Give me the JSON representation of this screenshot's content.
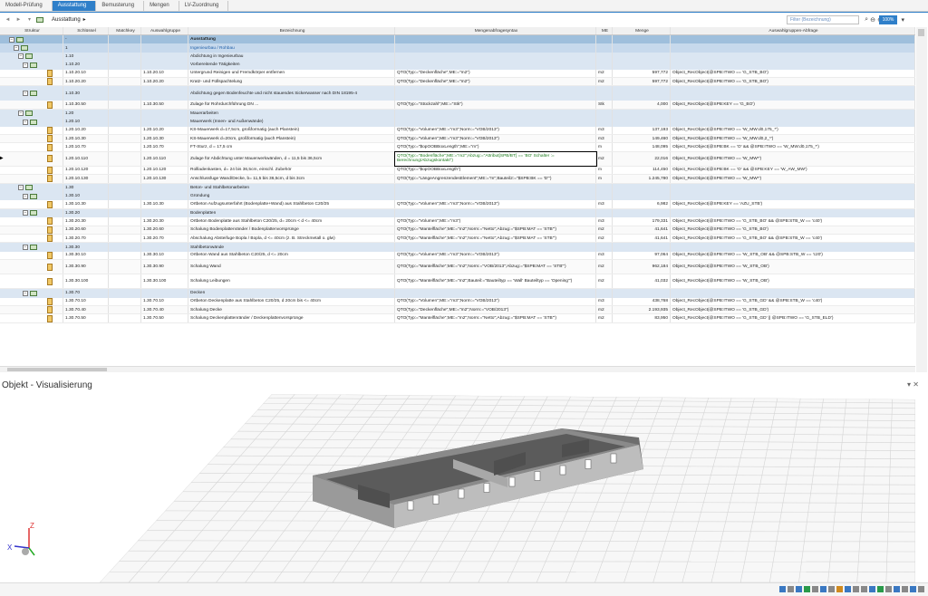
{
  "wizard": {
    "steps": [
      {
        "label": "Modell-Prüfung"
      },
      {
        "label": "Ausstattung"
      },
      {
        "label": "Bemusterung"
      },
      {
        "label": "Mengen"
      },
      {
        "label": "LV-Zuordnung"
      }
    ]
  },
  "toolbar": {
    "combo_value": "Ausstattung",
    "filter_placeholder": "Filter (Bezeichnung)",
    "zoom_value": "100%"
  },
  "columns": {
    "struktur": "Struktur",
    "schluessel": "Schlüssel",
    "matchkey": "Matchkey",
    "auswahlgruppe": "Auswahlgruppe",
    "bezeichnung": "Bezeichnung",
    "mengenabfrage": "Mengenabfragesyntax",
    "me": "ME",
    "menge": "Menge",
    "abfrage": "Auswahlgruppen-Abfrage"
  },
  "rows": [
    {
      "kind": "g0",
      "level": 0,
      "icon": "tree",
      "key": "-",
      "group": "",
      "name": "Ausstattung",
      "syntax": "",
      "me": "",
      "qty": "",
      "query": ""
    },
    {
      "kind": "g1",
      "level": 1,
      "icon": "tree",
      "key": "1",
      "group": "",
      "name": "Ingenieurbau / Rohbau",
      "syntax": "",
      "me": "",
      "qty": "",
      "query": ""
    },
    {
      "kind": "g2",
      "level": 2,
      "icon": "tree",
      "key": "1.10",
      "group": "",
      "name": "Abdichtung in Ingenieurbau",
      "syntax": "",
      "me": "",
      "qty": "",
      "query": ""
    },
    {
      "kind": "g2",
      "level": 3,
      "icon": "tree",
      "key": "1.10.20",
      "group": "",
      "name": "Vorbereitende Tätigkeiten",
      "syntax": "",
      "me": "",
      "qty": "",
      "query": ""
    },
    {
      "kind": "leaf",
      "level": 4,
      "icon": "pos",
      "key": "1.10.20.10",
      "group": "1.10.20.10",
      "name": "Untergrund Reinigen und Fremdkörper entfernen",
      "syntax": "QTO(Typ:=\"Deckenfläche\";ME:=\"m2\")",
      "me": "m2",
      "qty": "597,772",
      "query": "Object_RecObject(@SPB:ITWO == 'G_STB_BO')"
    },
    {
      "kind": "leaf",
      "level": 4,
      "icon": "pos",
      "key": "1.10.20.20",
      "group": "1.10.20.20",
      "name": "Kratz- und Füllspachtelung",
      "syntax": "QTO(Typ:=\"Deckenfläche\";ME:=\"m2\")",
      "me": "m2",
      "qty": "597,772",
      "query": "Object_RecObject(@SPB:ITWO == 'G_STB_BO')"
    },
    {
      "kind": "g2",
      "level": 3,
      "icon": "tree",
      "key": "1.10.30",
      "group": "",
      "name": "Abdichtung gegen Bodenfeuchte und nicht stauendes Sickerwasser nach DIN 18195-4",
      "syntax": "",
      "me": "",
      "qty": "",
      "query": "",
      "tall": true
    },
    {
      "kind": "leaf",
      "level": 4,
      "icon": "pos",
      "key": "1.10.30.50",
      "group": "1.10.30.50",
      "name": "Zulage für Rohrdurchführung DN ...",
      "syntax": "QTO(Typ:=\"Stückzahl\";ME:=\"Stk\")",
      "me": "Stk",
      "qty": "4,000",
      "query": "Object_RecObject(@SPB:KEY == 'G_BO')"
    },
    {
      "kind": "g2",
      "level": 2,
      "icon": "tree",
      "key": "1.20",
      "group": "",
      "name": "Mauerarbeiten",
      "syntax": "",
      "me": "",
      "qty": "",
      "query": ""
    },
    {
      "kind": "g2",
      "level": 3,
      "icon": "tree",
      "key": "1.20.10",
      "group": "",
      "name": "Mauerwerk (Innen- und Außenwände)",
      "syntax": "",
      "me": "",
      "qty": "",
      "query": ""
    },
    {
      "kind": "leaf",
      "level": 4,
      "icon": "pos",
      "key": "1.20.10.20",
      "group": "1.20.10.20",
      "name": "KS-Mauerwerk d=17,5cm, großformatig (auch Planstein)",
      "syntax": "QTO(Typ:=\"Volumen\";ME:=\"m3\";Norm:=\"VOB/2013\")",
      "me": "m3",
      "qty": "137,193",
      "query": "Object_RecObject(@SPB:ITWO == 'W_MW:d0,175_*')"
    },
    {
      "kind": "leaf",
      "level": 4,
      "icon": "pos",
      "key": "1.20.10.30",
      "group": "1.20.10.30",
      "name": "KS-Mauerwerk d=20cm, großformatig (auch Planstein)",
      "syntax": "QTO(Typ:=\"Volumen\";ME:=\"m3\";Norm:=\"VOB/2013\")",
      "me": "m3",
      "qty": "149,460",
      "query": "Object_RecObject(@SPB:ITWO == 'W_MW:d0,2_*')"
    },
    {
      "kind": "leaf",
      "level": 4,
      "icon": "pos",
      "key": "1.20.10.70",
      "group": "1.20.10.70",
      "name": "FT-Sturz, d = 17,5 cm",
      "syntax": "QTO(Typ:=\"$opOOBBoxLength\";ME:=\"m\")",
      "me": "m",
      "qty": "148,095",
      "query": "Object_RecObject(@SPB:BK == 'O' && @SPB:ITWO == 'W_MW:d0,175_*')"
    },
    {
      "kind": "leaf",
      "level": 4,
      "icon": "pos",
      "key": "1.20.10.110",
      "group": "1.20.10.110",
      "name": "Zulage für Abdichtung unter Mauerwerkwänden, d = 11,5 bis 36,5cm",
      "syntax": "QTO(Typ:=\"Bodenfläche\";ME:=\"m2\";Abzug:=\"Attribut[SPB/BT] == 'BO' Schalter := Berechnung/Abzugskontakt\")",
      "me": "m2",
      "qty": "22,016",
      "query": "Object_RecObject(@SPB:ITWO == 'W_MW*')",
      "selected": true,
      "tall": true
    },
    {
      "kind": "leaf",
      "level": 4,
      "icon": "pos",
      "key": "1.20.10.120",
      "group": "1.20.10.120",
      "name": "Rollladenkasten, d= 24 bis 36,5cm, einschl. Zubehör",
      "syntax": "QTO(Typ:=\"$opOOBBoxLength\")",
      "me": "m",
      "qty": "114,450",
      "query": "Object_RecObject(@SPB:BK == 'O' && @SPB:KEY == 'W_AW_MW')"
    },
    {
      "kind": "leaf",
      "level": 4,
      "icon": "pos",
      "key": "1.20.10.130",
      "group": "1.20.10.130",
      "name": "Anschlussfuge Wand/Decke, b= 11,5 bis 36,5cm, d bis 3cm",
      "syntax": "QTO(Typ:=\"LängeAngrenzendesElement\";ME:=\"m\";Bauteil2:=\"$SPB:BK == 'D'\")",
      "me": "m",
      "qty": "1.245,780",
      "query": "Object_RecObject(@SPB:ITWO == 'W_MW*')"
    },
    {
      "kind": "g2",
      "level": 2,
      "icon": "tree",
      "key": "1.30",
      "group": "",
      "name": "Beton- und Stahlbetonarbeiten",
      "syntax": "",
      "me": "",
      "qty": "",
      "query": ""
    },
    {
      "kind": "g2",
      "level": 3,
      "icon": "tree",
      "key": "1.30.10",
      "group": "",
      "name": "Gründung",
      "syntax": "",
      "me": "",
      "qty": "",
      "query": ""
    },
    {
      "kind": "leaf",
      "level": 4,
      "icon": "pos",
      "key": "1.30.10.30",
      "group": "1.30.10.30",
      "name": "Ortbeton Aufzugsunterfahrt (Bodenplatte+Wand) aus Stahlbeton C20/25",
      "syntax": "QTO(Typ:=\"Volumen\";ME:=\"m3\";Norm:=\"VOB/2013\")",
      "me": "m3",
      "qty": "6,982",
      "query": "Object_RecObject(@SPB:KEY == 'AZU_STB')"
    },
    {
      "kind": "g2",
      "level": 3,
      "icon": "tree",
      "key": "1.30.20",
      "group": "",
      "name": "Bodenplatten",
      "syntax": "",
      "me": "",
      "qty": "",
      "query": ""
    },
    {
      "kind": "leaf",
      "level": 4,
      "icon": "pos",
      "key": "1.30.20.30",
      "group": "1.30.20.30",
      "name": "Ortbeton Bodenplatte aus Stahlbeton C20/25, d= 20cm < d <= 40cm",
      "syntax": "QTO(Typ:=\"Volumen\";ME:=\"m3\")",
      "me": "m3",
      "qty": "179,331",
      "query": "Object_RecObject(@SPB:ITWO == 'G_STB_BO' && @SPB:STB_W == 'c40')"
    },
    {
      "kind": "leaf",
      "level": 4,
      "icon": "pos",
      "key": "1.30.20.60",
      "group": "1.30.20.60",
      "name": "Schalung Bodenplattenränder / Bodenplattenvorsprünge",
      "syntax": "QTO(Typ:=\"Mantelfläche\";ME:=\"m2\";Norm:=\"Netto\";Abzug:=\"$SPB:MAT == 'STB'\")",
      "me": "m2",
      "qty": "41,641",
      "query": "Object_RecObject(@SPB:ITWO == 'G_STB_BO')"
    },
    {
      "kind": "leaf",
      "level": 4,
      "icon": "pos",
      "key": "1.30.20.70",
      "group": "1.30.20.70",
      "name": "Abschalung Absteifuge Bopla / Bopla, d <= 40cm (z. B. Streckmetall o. glw)",
      "syntax": "QTO(Typ:=\"Mantelfläche\";ME:=\"m2\";Norm:=\"Netto\";Abzug:=\"$SPB:MAT == 'STB'\")",
      "me": "m2",
      "qty": "41,641",
      "query": "Object_RecObject(@SPB:ITWO == 'G_STB_BO' && @SPB:STB_W == 'c40')"
    },
    {
      "kind": "g2",
      "level": 3,
      "icon": "tree",
      "key": "1.30.30",
      "group": "",
      "name": "Stahlbetonwände",
      "syntax": "",
      "me": "",
      "qty": "",
      "query": ""
    },
    {
      "kind": "leaf",
      "level": 4,
      "icon": "pos",
      "key": "1.30.30.10",
      "group": "1.30.30.10",
      "name": "Ortbeton Wand aus Stahlbeton C20/25, d <= 20cm",
      "syntax": "QTO(Typ:=\"Volumen\";ME:=\"m3\";Norm:=\"VOB/2013\")",
      "me": "m3",
      "qty": "97,064",
      "query": "Object_RecObject(@SPB:ITWO == 'W_STB_OB' && @SPB:STB_W == 'c20')"
    },
    {
      "kind": "leaf",
      "level": 4,
      "icon": "pos",
      "key": "1.30.30.90",
      "group": "1.30.30.90",
      "name": "Schalung Wand",
      "syntax": "QTO(Typ:=\"Mantelfläche\";ME:=\"m2\";Norm:=\"VOB/2013\";Abzug:=\"$SPB:MAT == 'STB'\")",
      "me": "m2",
      "qty": "962,184",
      "query": "Object_RecObject(@SPB:ITWO == 'W_STB_OB')",
      "tall": true
    },
    {
      "kind": "leaf",
      "level": 4,
      "icon": "pos",
      "key": "1.30.30.100",
      "group": "1.30.30.100",
      "name": "Schalung Leibungen",
      "syntax": "QTO(Typ:=\"Mantelfläche\";ME:=\"m2\";Bauteil:=\"Bauteiltyp == 'Wall' Bauteiltyp == 'Opening'\")",
      "me": "m2",
      "qty": "41,032",
      "query": "Object_RecObject(@SPB:ITWO == 'W_STB_OB')",
      "tall": true
    },
    {
      "kind": "g2",
      "level": 3,
      "icon": "tree",
      "key": "1.30.70",
      "group": "",
      "name": "Decken",
      "syntax": "",
      "me": "",
      "qty": "",
      "query": ""
    },
    {
      "kind": "leaf",
      "level": 4,
      "icon": "pos",
      "key": "1.30.70.10",
      "group": "1.30.70.10",
      "name": "Ortbeton Deckenplatte aus Stahlbeton C20/25, d 20cm bis <= 40cm",
      "syntax": "QTO(Typ:=\"Volumen\";ME:=\"m3\";Norm:=\"VOB/2013\")",
      "me": "m3",
      "qty": "438,768",
      "query": "Object_RecObject(@SPB:ITWO == 'G_STB_GD' && @SPB:STB_W == 'c40')"
    },
    {
      "kind": "leaf",
      "level": 4,
      "icon": "pos",
      "key": "1.30.70.40",
      "group": "1.30.70.40",
      "name": "Schalung Decke",
      "syntax": "QTO(Typ:=\"Deckenfläche\";ME:=\"m2\";Norm:=\"VOB/2013\")",
      "me": "m2",
      "qty": "2.193,935",
      "query": "Object_RecObject(@SPB:ITWO == 'G_STB_GD')"
    },
    {
      "kind": "leaf",
      "level": 4,
      "icon": "pos",
      "key": "1.30.70.50",
      "group": "1.30.70.50",
      "name": "Schalung Deckenplattenränder / Deckenplattenvorsprünge",
      "syntax": "QTO(Typ:=\"Mantelfläche\";ME:=\"m2\";Norm:=\"Netto\";Abzug:=\"$SPB:MAT == 'STB'\")",
      "me": "m2",
      "qty": "83,950",
      "query": "Object_RecObject(@SPB:ITWO == 'G_STB_GD' || @SPB:ITWO == 'G_STB_ELD')"
    }
  ],
  "viewer": {
    "title": "Objekt - Visualisierung",
    "axis_x": "X",
    "axis_z": "Z"
  }
}
